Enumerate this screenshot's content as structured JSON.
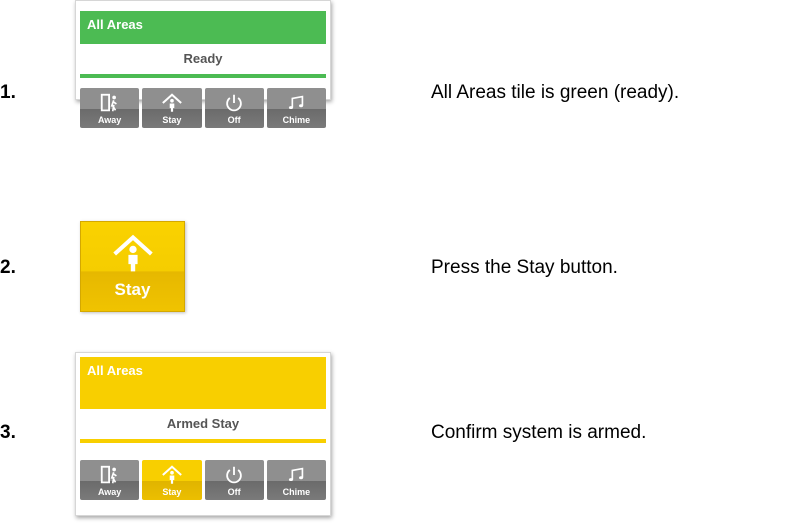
{
  "colors": {
    "green": "#4cbb53",
    "yellow": "#f8cf00",
    "gray": "#8f8f8f"
  },
  "steps": [
    {
      "number": "1.",
      "description": "All Areas tile is green (ready).",
      "tile": {
        "header": "All Areas",
        "status": "Ready",
        "state_color": "green",
        "buttons": [
          {
            "label": "Away",
            "icon": "away-icon",
            "active": false
          },
          {
            "label": "Stay",
            "icon": "stay-home-icon",
            "active": false
          },
          {
            "label": "Off",
            "icon": "power-icon",
            "active": false
          },
          {
            "label": "Chime",
            "icon": "chime-icon",
            "active": false
          }
        ]
      }
    },
    {
      "number": "2.",
      "description": "Press the Stay button.",
      "button": {
        "label": "Stay",
        "icon": "stay-home-icon"
      }
    },
    {
      "number": "3.",
      "description": "Confirm system is armed.",
      "tile": {
        "header": "All Areas",
        "status": "Armed Stay",
        "state_color": "yellow",
        "buttons": [
          {
            "label": "Away",
            "icon": "away-icon",
            "active": false
          },
          {
            "label": "Stay",
            "icon": "stay-home-icon",
            "active": true
          },
          {
            "label": "Off",
            "icon": "power-icon",
            "active": false
          },
          {
            "label": "Chime",
            "icon": "chime-icon",
            "active": false
          }
        ]
      }
    }
  ]
}
